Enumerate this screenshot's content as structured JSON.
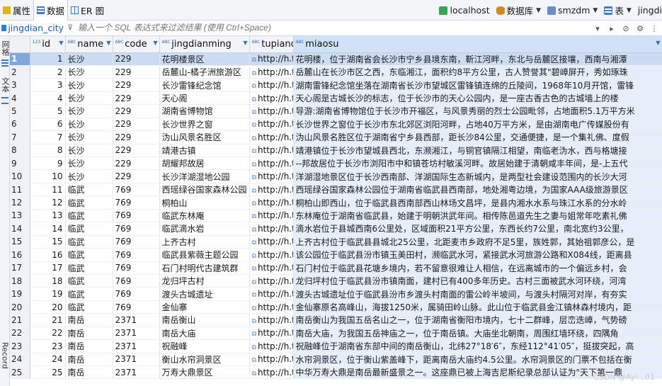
{
  "toolbar": {
    "tabs": [
      {
        "label": "属性"
      },
      {
        "label": "数据"
      },
      {
        "label": "ER 图"
      }
    ],
    "connection": "localhost",
    "database_label": "数据库",
    "schema": "smzdm",
    "table_label": "表",
    "table_name": "jingdi"
  },
  "filterbar": {
    "table_name": "jingdian_city",
    "placeholder": "输入一个 SQL 表达式来过滤结果 (使用 Ctrl+Space)"
  },
  "leftpanel": {
    "grid_label": "网格",
    "text_label": "文本",
    "record_label": "Record"
  },
  "columns": [
    {
      "name": "id"
    },
    {
      "name": "name"
    },
    {
      "name": "code"
    },
    {
      "name": "jingdianming"
    },
    {
      "name": "tupiandi"
    },
    {
      "name": "miaosu"
    }
  ],
  "rows": [
    {
      "n": "1",
      "id": "1",
      "name": "长沙",
      "code": "229",
      "jd": "花明楼景区",
      "url": "http://h.t",
      "ms": "花明楼，位于湖南省会长沙市宁乡县境东南，靳江河畔，东北与岳麓区接壤，西南与湘潭"
    },
    {
      "n": "2",
      "id": "2",
      "name": "长沙",
      "code": "229",
      "jd": "岳麓山-橘子洲旅游区",
      "url": "http://h.t",
      "ms": "岳麓山在长沙市区之西，东临湘江，面积约8平方公里，古人赞誉其\"碧嶂屏开，秀如琢珠"
    },
    {
      "n": "3",
      "id": "3",
      "name": "长沙",
      "code": "229",
      "jd": "长沙雷锋纪念馆",
      "url": "http://h.t",
      "ms": "湖南雷锋纪念馆坐落在湖南省长沙市望城区雷锋镇连绵的丘陵间，1968年10月开馆，雷锋"
    },
    {
      "n": "4",
      "id": "4",
      "name": "长沙",
      "code": "229",
      "jd": "天心阁",
      "url": "http://h.t",
      "ms": "天心阁是古城长沙的标志，位于长沙市的天心公园内，是一座古香古色的古城墙上的楼"
    },
    {
      "n": "5",
      "id": "5",
      "name": "长沙",
      "code": "229",
      "jd": "湖南省博物馆",
      "url": "http://h.t",
      "ms": "导游:湖南省博物馆位于长沙市开福区，与风景秀丽的烈士公园毗邻，占地面积5.1万平方米"
    },
    {
      "n": "6",
      "id": "6",
      "name": "长沙",
      "code": "229",
      "jd": "长沙世界之窗",
      "url": "http://h.t",
      "ms": "长沙世界之窗位于长沙市东北郊区浏阳河畔，占地40万平方米，是由湖南电广传媒股份有"
    },
    {
      "n": "7",
      "id": "7",
      "name": "长沙",
      "code": "229",
      "jd": "沩山风景名胜区",
      "url": "http://h.t",
      "ms": "沩山风景名胜区位于湖南省宁乡县西部，距长沙84公里，交通便捷，是一个集礼佛、度假"
    },
    {
      "n": "8",
      "id": "8",
      "name": "长沙",
      "code": "229",
      "jd": "靖港古镇",
      "url": "http://h.t",
      "ms": "靖港镇位于长沙市望城县西北，东濒湘江，与铜官镇隔江相望，南临老沩水，西与格塘接"
    },
    {
      "n": "9",
      "id": "9",
      "name": "长沙",
      "code": "229",
      "jd": "胡耀邦故居",
      "url": "http://h.t",
      "ms": "--邦故居位于长沙市浏阳市中和镇苍坊村敏溪河畔。故居始建于清朝咸丰年间，是-上五代"
    },
    {
      "n": "10",
      "id": "10",
      "name": "长沙",
      "code": "229",
      "jd": "长沙洋湖湿地公园",
      "url": "http://h.t",
      "ms": "洋湖湿地景区位于长沙西南部、洋湖国际生态新城内，是两型社会建设范围内的长沙大河"
    },
    {
      "n": "11",
      "id": "11",
      "name": "临武",
      "code": "769",
      "jd": "西瑶绿谷国家森林公园",
      "url": "http://h.t",
      "ms": "西瑶绿谷国家森林公园位于湖南省临武县西南部，地处湘粤边境，为国家AAA级旅游景区"
    },
    {
      "n": "12",
      "id": "12",
      "name": "临武",
      "code": "769",
      "jd": "桐柏山",
      "url": "http://h.t",
      "ms": "桐柏山即西山，位于临武县西南部西山林场文昌坪，是县内湘水水系与珠江水系的分水岭"
    },
    {
      "n": "13",
      "id": "13",
      "name": "临武",
      "code": "769",
      "jd": "临武东林庵",
      "url": "http://h.t",
      "ms": "东林庵位于湖南省临武县，始建于明朝洪武年间。相传陈邑道先生之妻与姐常年吃素礼佛"
    },
    {
      "n": "14",
      "id": "14",
      "name": "临武",
      "code": "769",
      "jd": "临武滴水岩",
      "url": "http://h.t",
      "ms": "滴水岩位于县城西南6公里处，区域面积21平方公里，东西长约7公里，南北宽约3公里，"
    },
    {
      "n": "15",
      "id": "15",
      "name": "临武",
      "code": "769",
      "jd": "上齐古村",
      "url": "http://h.t",
      "ms": "上齐古村位于临武县县城北25公里，北距麦市乡政府不足5里，族姓郭，其始祖郭彦公，是"
    },
    {
      "n": "16",
      "id": "16",
      "name": "临武",
      "code": "769",
      "jd": "临武县紫薇主题公园",
      "url": "http://h.t",
      "ms": "该公园位于临武县汾市镇玉美田村，濒临武水河，紧接武水河旅游公路和X084线，距离县"
    },
    {
      "n": "17",
      "id": "17",
      "name": "临武",
      "code": "769",
      "jd": "石门村明代古建筑群",
      "url": "http://h.t",
      "ms": "石门村位于临武县花塘乡境内，若不留意很难让人相信，在远离城市的一个偏远乡村，会"
    },
    {
      "n": "18",
      "id": "18",
      "name": "临武",
      "code": "769",
      "jd": "龙归坪古村",
      "url": "http://h.t",
      "ms": "龙归坪村位于临武县汾市镇南面，建村已有400多年历史。古村三面被武水河环绕，河湾"
    },
    {
      "n": "19",
      "id": "19",
      "name": "临武",
      "code": "769",
      "jd": "渡头古城遗址",
      "url": "http://h.t",
      "ms": "渡头古城遗址位于临武县汾市乡渡头村南面的雷公岭半坡间，与渡头村隔河对岸，有夯实"
    },
    {
      "n": "20",
      "id": "20",
      "name": "临武",
      "code": "769",
      "jd": "金仙寨",
      "url": "http://h.t",
      "ms": "金仙寨原名高峰山，海拔1250米，属骑田岭山脉。此山位于临武县金江镇林森村境内，距"
    },
    {
      "n": "21",
      "id": "21",
      "name": "南岳",
      "code": "2371",
      "jd": "南岳衡山",
      "url": "http://h.t",
      "ms": "南岳衡山为我国五岳名山之一，位于湖南省衡阳市境内，七十二群峰，层峦迭嶂，气势磅"
    },
    {
      "n": "22",
      "id": "22",
      "name": "南岳",
      "code": "2371",
      "jd": "南岳大庙",
      "url": "http://h.t",
      "ms": "南岳大庙，为我国五岳神庙之一，位于南岳镇。大庙坐北朝南，周围红墙环绕，四隅角"
    },
    {
      "n": "23",
      "id": "23",
      "name": "南岳",
      "code": "2371",
      "jd": "祝融峰",
      "url": "http://h.t",
      "ms": "祝融峰位于湖南省东部中间的南岳衡山，北纬27°18′6″，东经112°41′05″，挺拔突起，高"
    },
    {
      "n": "24",
      "id": "24",
      "name": "南岳",
      "code": "2371",
      "jd": "衡山水帘洞景区",
      "url": "http://h.t",
      "ms": "水帘洞景区，位于衡山紫盖峰下，距离南岳大庙约4.5公里。水帘洞景区的门票不包括在衡"
    },
    {
      "n": "25",
      "id": "25",
      "name": "南岳",
      "code": "2371",
      "jd": "万寿大鼎景区",
      "url": "http://h.t",
      "ms": "中华万寿大鼎是南岳最新盛景之一。这座鼎已被上海吉尼斯纪录总部认证为\"天下第一鼎"
    }
  ],
  "watermark": "CSDN @Ayi...01"
}
